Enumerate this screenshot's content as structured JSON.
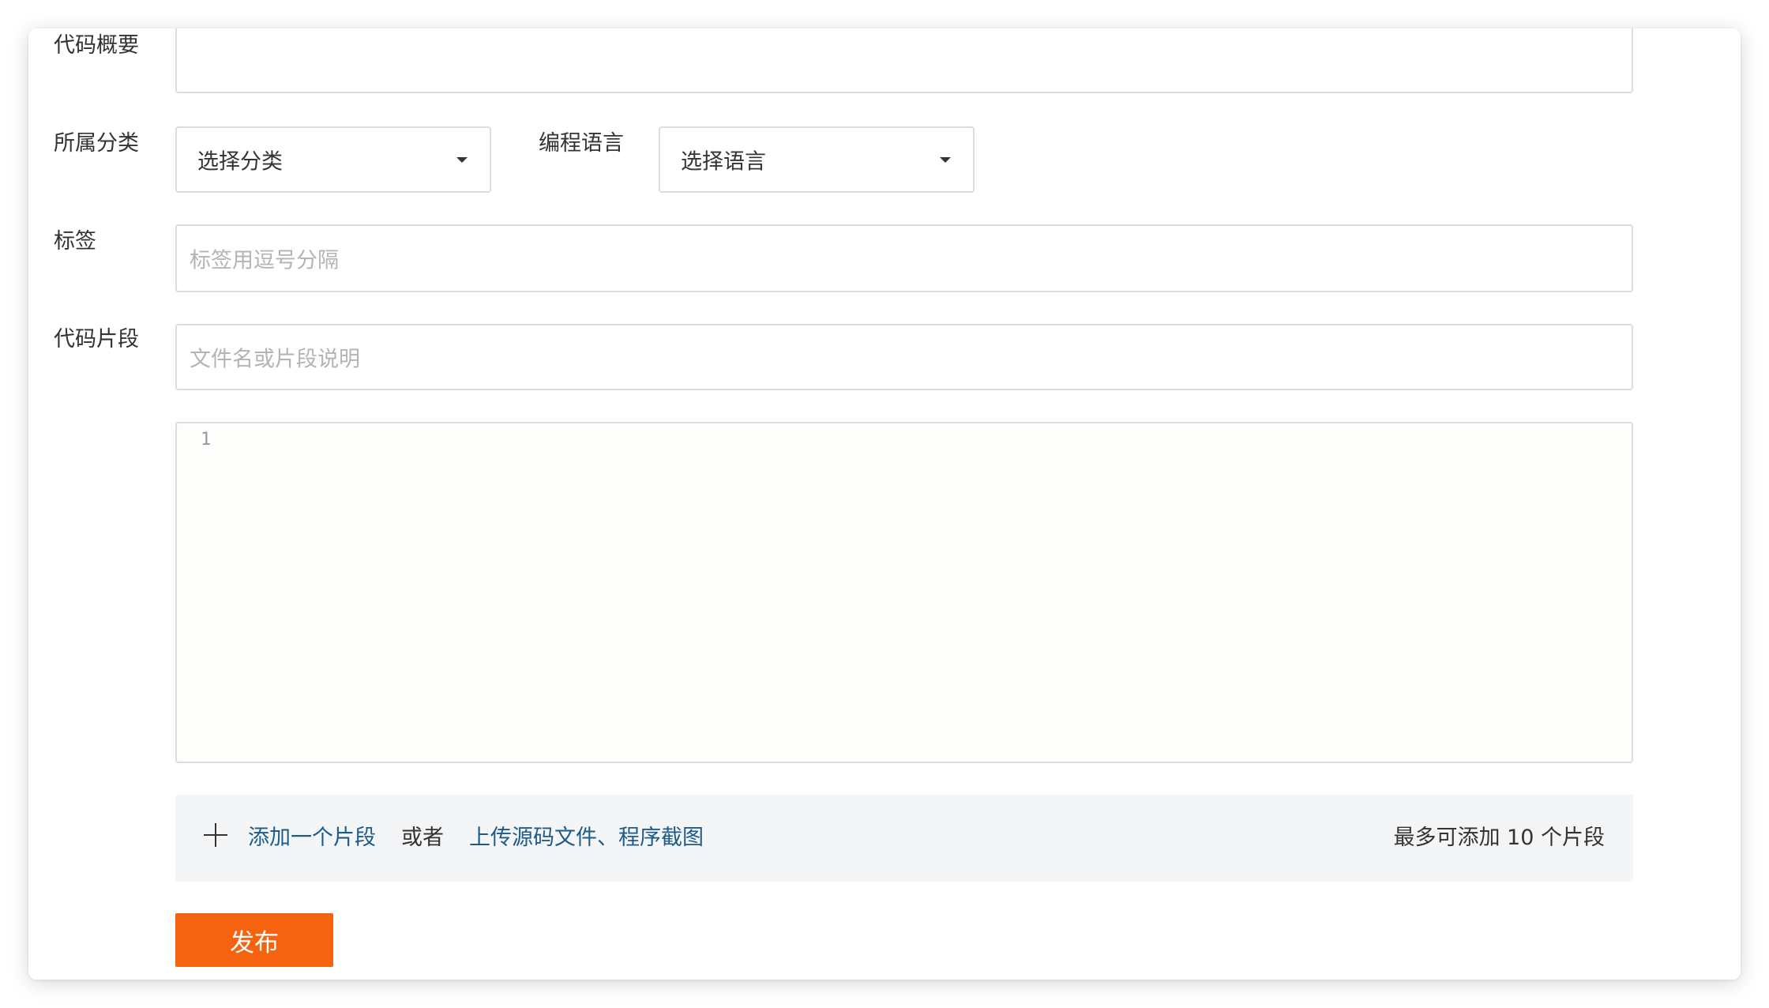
{
  "form": {
    "summary": {
      "label": "代码概要",
      "value": ""
    },
    "category": {
      "label": "所属分类",
      "selected": "选择分类"
    },
    "language": {
      "label": "编程语言",
      "selected": "选择语言"
    },
    "tags": {
      "label": "标签",
      "placeholder": "标签用逗号分隔"
    },
    "snippet": {
      "label": "代码片段",
      "filename_placeholder": "文件名或片段说明",
      "line_number": "1"
    },
    "toolbar": {
      "add_label": "添加一个片段",
      "or_label": "或者",
      "upload_label": "上传源码文件、程序截图",
      "limit_label": "最多可添加 10 个片段"
    },
    "publish_label": "发布"
  },
  "colors": {
    "accent": "#f56311",
    "link": "#1d5b8a"
  },
  "icons": {
    "add": "plus-icon",
    "dropdown": "caret-down-icon"
  }
}
